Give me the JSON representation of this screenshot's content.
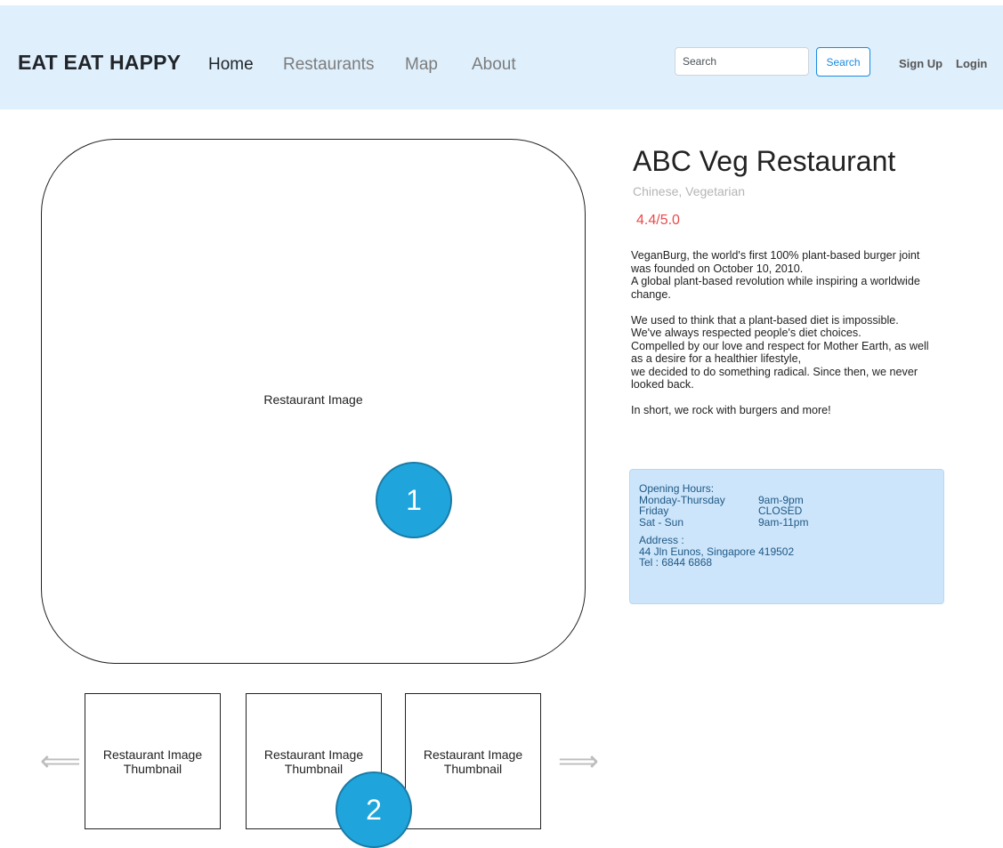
{
  "navbar": {
    "brand": "EAT EAT HAPPY",
    "links": [
      {
        "label": "Home",
        "active": true
      },
      {
        "label": "Restaurants",
        "active": false
      },
      {
        "label": "Map",
        "active": false
      },
      {
        "label": "About",
        "active": false
      }
    ],
    "search": {
      "placeholder": "Search",
      "value": "",
      "button_label": "Search"
    },
    "auth": {
      "signup_label": "Sign Up",
      "login_label": "Login"
    }
  },
  "gallery": {
    "main_image_label": "Restaurant Image",
    "thumbnails": [
      {
        "line1": "Restaurant Image",
        "line2": "Thumbnail"
      },
      {
        "line1": "Restaurant Image",
        "line2": "Thumbnail"
      },
      {
        "line1": "Restaurant Image",
        "line2": "Thumbnail"
      }
    ],
    "prev_arrow": "⟸",
    "next_arrow": "⟹",
    "prev_icon": "left-arrow-icon",
    "next_icon": "right-arrow-icon"
  },
  "callouts": [
    "1",
    "2"
  ],
  "restaurant": {
    "name": "ABC Veg Restaurant",
    "cuisine": "Chinese, Vegetarian",
    "rating": "4.4/5.0",
    "description": [
      [
        "VeganBurg, the world's first 100% plant-based burger joint was founded on October 10, 2010.",
        "A global plant-based revolution while inspiring a worldwide change."
      ],
      [
        "We used to think that a plant-based diet is impossible.",
        "We've always respected people's diet choices.",
        "Compelled by our love and respect for Mother Earth, as well as a desire for a healthier lifestyle,",
        "we decided to do something radical. Since then, we never looked back."
      ],
      [
        "In short, we rock with burgers and more!"
      ]
    ]
  },
  "info": {
    "hours_title": "Opening Hours:",
    "hours": [
      {
        "day": "Monday-Thursday",
        "time": "9am-9pm"
      },
      {
        "day": "Friday",
        "time": "CLOSED"
      },
      {
        "day": "Sat - Sun",
        "time": "9am-11pm"
      }
    ],
    "address_title": "Address :",
    "address": "44 Jln Eunos, Singapore 419502",
    "tel": "Tel : 6844 6868"
  },
  "colors": {
    "navbar_bg": "#dfeffc",
    "accent": "#1a8be0",
    "rating": "#e84b4b",
    "info_bg": "#cce5fb",
    "info_text": "#1f5884",
    "callout": "#1fa5dc"
  }
}
